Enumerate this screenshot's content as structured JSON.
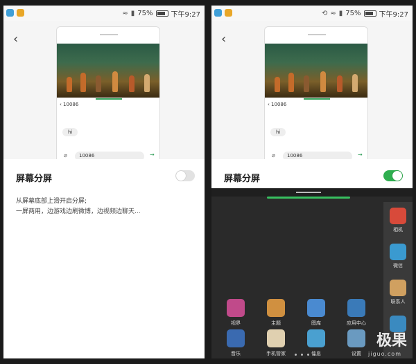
{
  "status_bar": {
    "battery": "75%",
    "time": "下午9:27"
  },
  "preview": {
    "chat_contact": "10086",
    "chat_message": "hi",
    "chat_input_value": "10086"
  },
  "setting": {
    "title": "屏幕分屏"
  },
  "left_state": {
    "toggle_on": false
  },
  "description_lines": [
    "从屏幕底部上滑开启分屏;",
    "一屏两用，边游戏边刷微博，边视频边聊天..."
  ],
  "right_state": {
    "toggle_on": true
  },
  "launcher": {
    "apps_row1": [
      "视界",
      "主题",
      "图库",
      "应用中心"
    ],
    "apps_row2": [
      "音乐",
      "手机管家",
      "信息",
      "设置"
    ],
    "dock": [
      "相机",
      "微信",
      "联系人"
    ]
  },
  "watermark": {
    "text": "极果",
    "sub": "jiguo.com"
  },
  "colors": {
    "accent_green": "#2fae4f",
    "toggle_off": "#e2e2e2",
    "dark_bg": "#2a2a2a"
  },
  "icons": [
    "back-icon",
    "wifi-icon",
    "signal-icon",
    "battery-icon",
    "attachment-icon",
    "send-icon"
  ]
}
